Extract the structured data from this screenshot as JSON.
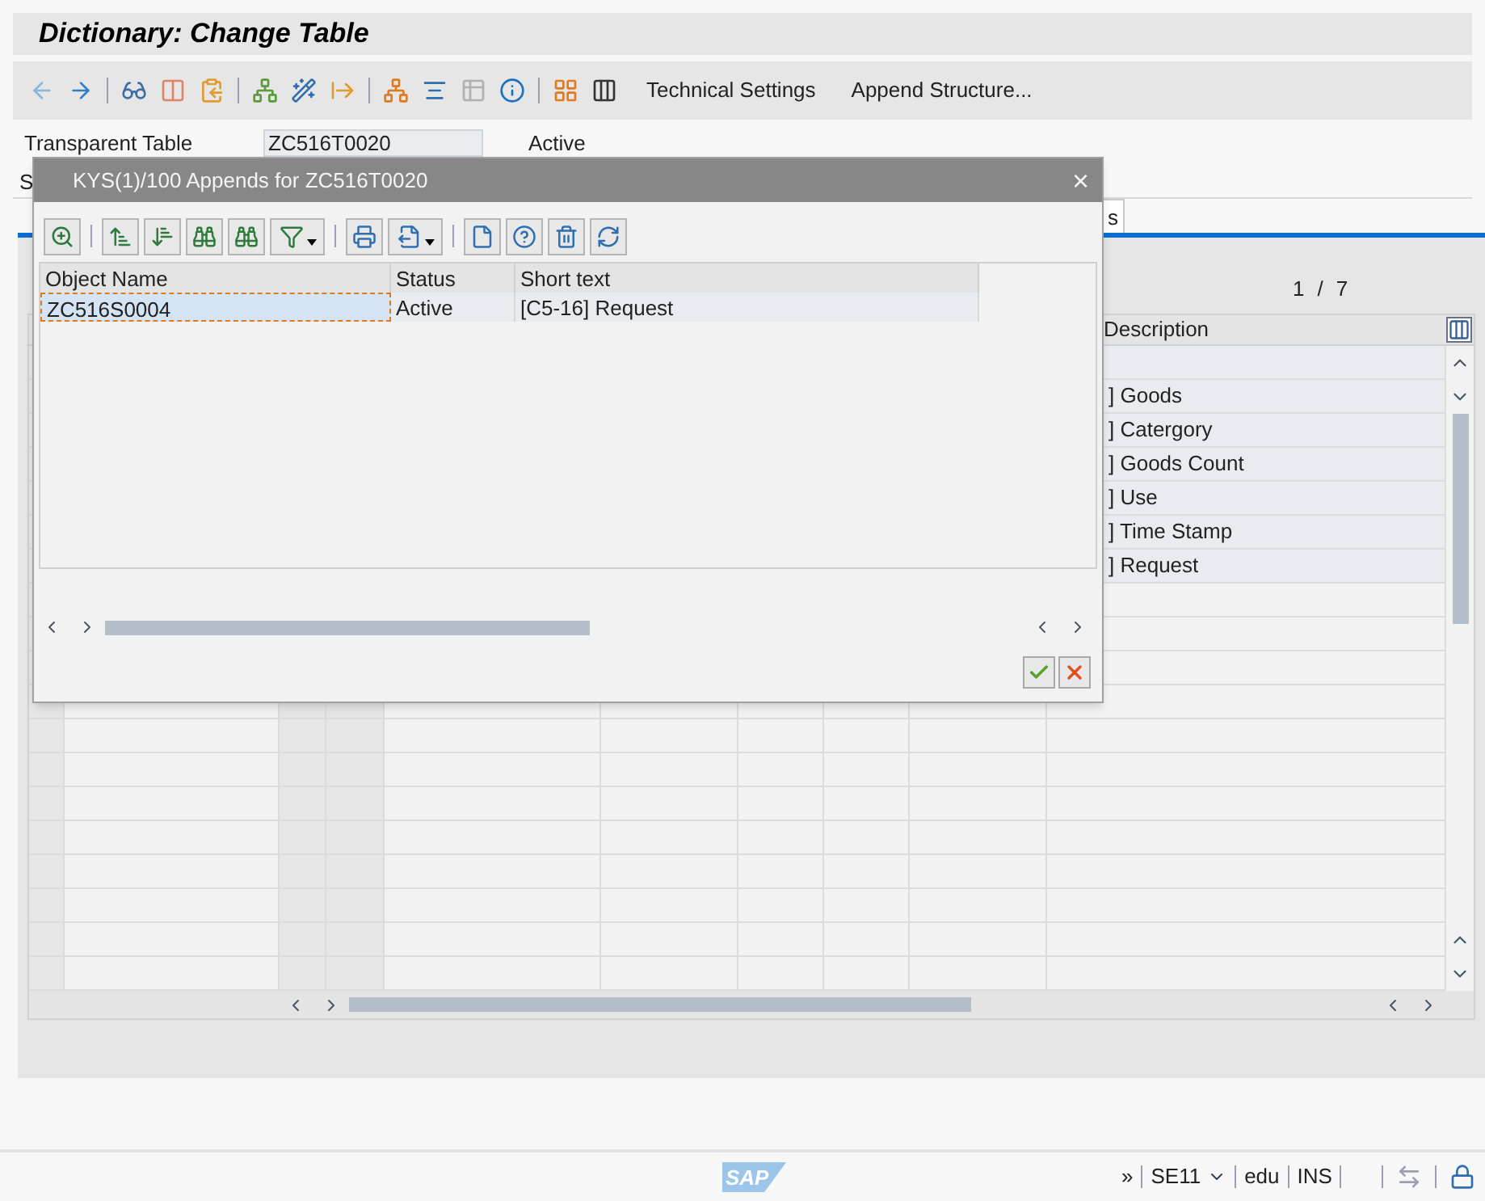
{
  "window": {
    "title": "Dictionary: Change Table"
  },
  "toolbar": {
    "buttons": [
      "Technical Settings",
      "Append Structure..."
    ]
  },
  "header_field": {
    "label": "Transparent Table",
    "value": "ZC516T0020",
    "status": "Active"
  },
  "short_description_label": "S",
  "tabs": [
    {
      "label": "s",
      "selected": true
    }
  ],
  "fields_table": {
    "page": "1",
    "separator": "/",
    "total": "7",
    "column": "Description",
    "rows": [
      "] Goods",
      "] Catergory",
      "] Goods Count",
      "] Use",
      "] Time Stamp",
      "] Request"
    ]
  },
  "dialog": {
    "title": "KYS(1)/100 Appends for ZC516T0020",
    "close": "×",
    "columns": [
      "Object Name",
      "Status",
      "Short text"
    ],
    "rows": [
      {
        "cells": [
          "ZC516S0004",
          "Active",
          "[C5-16] Request"
        ],
        "selected": true
      }
    ]
  },
  "status_bar": {
    "logo": "SAP",
    "expand": "»",
    "transaction": "SE11",
    "client": "edu",
    "mode": "INS"
  }
}
